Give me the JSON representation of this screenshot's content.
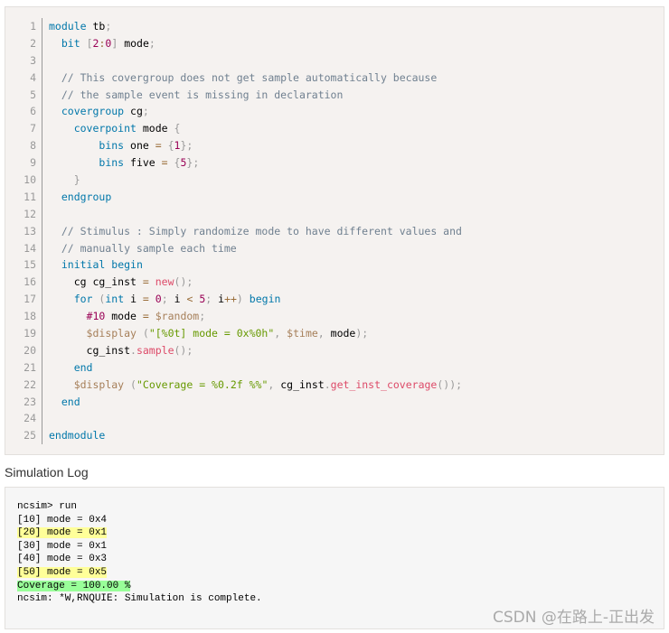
{
  "code": {
    "line_numbers": [
      "1",
      "2",
      "3",
      "4",
      "5",
      "6",
      "7",
      "8",
      "9",
      "10",
      "11",
      "12",
      "13",
      "14",
      "15",
      "16",
      "17",
      "18",
      "19",
      "20",
      "21",
      "22",
      "23",
      "24",
      "25"
    ],
    "lines": [
      [
        {
          "t": "module",
          "c": "kw"
        },
        {
          "t": " tb",
          "c": ""
        },
        {
          "t": ";",
          "c": "pun"
        }
      ],
      [
        {
          "t": "  ",
          "c": ""
        },
        {
          "t": "bit",
          "c": "kw"
        },
        {
          "t": " ",
          "c": ""
        },
        {
          "t": "[",
          "c": "pun"
        },
        {
          "t": "2",
          "c": "num"
        },
        {
          "t": ":",
          "c": "op"
        },
        {
          "t": "0",
          "c": "num"
        },
        {
          "t": "]",
          "c": "pun"
        },
        {
          "t": " mode",
          "c": ""
        },
        {
          "t": ";",
          "c": "pun"
        }
      ],
      [],
      [
        {
          "t": "  // This covergroup does not get sample automatically because",
          "c": "com"
        }
      ],
      [
        {
          "t": "  // the sample event is missing in declaration",
          "c": "com"
        }
      ],
      [
        {
          "t": "  ",
          "c": ""
        },
        {
          "t": "covergroup",
          "c": "kw"
        },
        {
          "t": " cg",
          "c": ""
        },
        {
          "t": ";",
          "c": "pun"
        }
      ],
      [
        {
          "t": "    ",
          "c": ""
        },
        {
          "t": "coverpoint",
          "c": "kw"
        },
        {
          "t": " mode ",
          "c": ""
        },
        {
          "t": "{",
          "c": "pun"
        }
      ],
      [
        {
          "t": "        ",
          "c": ""
        },
        {
          "t": "bins",
          "c": "kw"
        },
        {
          "t": " one ",
          "c": ""
        },
        {
          "t": "=",
          "c": "op"
        },
        {
          "t": " ",
          "c": ""
        },
        {
          "t": "{",
          "c": "pun"
        },
        {
          "t": "1",
          "c": "num"
        },
        {
          "t": "}",
          "c": "pun"
        },
        {
          "t": ";",
          "c": "pun"
        }
      ],
      [
        {
          "t": "        ",
          "c": ""
        },
        {
          "t": "bins",
          "c": "kw"
        },
        {
          "t": " five ",
          "c": ""
        },
        {
          "t": "=",
          "c": "op"
        },
        {
          "t": " ",
          "c": ""
        },
        {
          "t": "{",
          "c": "pun"
        },
        {
          "t": "5",
          "c": "num"
        },
        {
          "t": "}",
          "c": "pun"
        },
        {
          "t": ";",
          "c": "pun"
        }
      ],
      [
        {
          "t": "    ",
          "c": ""
        },
        {
          "t": "}",
          "c": "pun"
        }
      ],
      [
        {
          "t": "  ",
          "c": ""
        },
        {
          "t": "endgroup",
          "c": "kw"
        }
      ],
      [],
      [
        {
          "t": "  // Stimulus : Simply randomize mode to have different values and",
          "c": "com"
        }
      ],
      [
        {
          "t": "  // manually sample each time",
          "c": "com"
        }
      ],
      [
        {
          "t": "  ",
          "c": ""
        },
        {
          "t": "initial",
          "c": "kw"
        },
        {
          "t": " ",
          "c": ""
        },
        {
          "t": "begin",
          "c": "kw"
        }
      ],
      [
        {
          "t": "    cg cg_inst ",
          "c": ""
        },
        {
          "t": "=",
          "c": "op"
        },
        {
          "t": " ",
          "c": ""
        },
        {
          "t": "new",
          "c": "fn"
        },
        {
          "t": "();",
          "c": "pun"
        }
      ],
      [
        {
          "t": "    ",
          "c": ""
        },
        {
          "t": "for",
          "c": "kw"
        },
        {
          "t": " ",
          "c": ""
        },
        {
          "t": "(",
          "c": "pun"
        },
        {
          "t": "int",
          "c": "kw"
        },
        {
          "t": " i ",
          "c": ""
        },
        {
          "t": "=",
          "c": "op"
        },
        {
          "t": " ",
          "c": ""
        },
        {
          "t": "0",
          "c": "num"
        },
        {
          "t": ";",
          "c": "pun"
        },
        {
          "t": " i ",
          "c": ""
        },
        {
          "t": "<",
          "c": "op"
        },
        {
          "t": " ",
          "c": ""
        },
        {
          "t": "5",
          "c": "num"
        },
        {
          "t": ";",
          "c": "pun"
        },
        {
          "t": " i",
          "c": ""
        },
        {
          "t": "++",
          "c": "op"
        },
        {
          "t": ")",
          "c": "pun"
        },
        {
          "t": " ",
          "c": ""
        },
        {
          "t": "begin",
          "c": "kw"
        }
      ],
      [
        {
          "t": "      ",
          "c": ""
        },
        {
          "t": "#10",
          "c": "num"
        },
        {
          "t": " mode ",
          "c": ""
        },
        {
          "t": "=",
          "c": "op"
        },
        {
          "t": " ",
          "c": ""
        },
        {
          "t": "$random",
          "c": "var"
        },
        {
          "t": ";",
          "c": "pun"
        }
      ],
      [
        {
          "t": "      ",
          "c": ""
        },
        {
          "t": "$display",
          "c": "var"
        },
        {
          "t": " ",
          "c": ""
        },
        {
          "t": "(",
          "c": "pun"
        },
        {
          "t": "\"[%0t] mode = 0x%0h\"",
          "c": "str"
        },
        {
          "t": ",",
          "c": "pun"
        },
        {
          "t": " ",
          "c": ""
        },
        {
          "t": "$time",
          "c": "var"
        },
        {
          "t": ",",
          "c": "pun"
        },
        {
          "t": " mode",
          "c": ""
        },
        {
          "t": ");",
          "c": "pun"
        }
      ],
      [
        {
          "t": "      cg_inst",
          "c": ""
        },
        {
          "t": ".",
          "c": "pun"
        },
        {
          "t": "sample",
          "c": "fn"
        },
        {
          "t": "();",
          "c": "pun"
        }
      ],
      [
        {
          "t": "    ",
          "c": ""
        },
        {
          "t": "end",
          "c": "kw"
        }
      ],
      [
        {
          "t": "    ",
          "c": ""
        },
        {
          "t": "$display",
          "c": "var"
        },
        {
          "t": " ",
          "c": ""
        },
        {
          "t": "(",
          "c": "pun"
        },
        {
          "t": "\"Coverage = %0.2f %%\"",
          "c": "str"
        },
        {
          "t": ",",
          "c": "pun"
        },
        {
          "t": " cg_inst",
          "c": ""
        },
        {
          "t": ".",
          "c": "pun"
        },
        {
          "t": "get_inst_coverage",
          "c": "fn"
        },
        {
          "t": "());",
          "c": "pun"
        }
      ],
      [
        {
          "t": "  ",
          "c": ""
        },
        {
          "t": "end",
          "c": "kw"
        }
      ],
      [],
      [
        {
          "t": "endmodule",
          "c": "kw"
        }
      ]
    ]
  },
  "section_title": "Simulation Log",
  "log": [
    {
      "text": "ncsim> run",
      "hl": ""
    },
    {
      "text": "[10] mode = 0x4",
      "hl": ""
    },
    {
      "text": "[20] mode = 0x1",
      "hl": "yellow"
    },
    {
      "text": "[30] mode = 0x1",
      "hl": ""
    },
    {
      "text": "[40] mode = 0x3",
      "hl": ""
    },
    {
      "text": "[50] mode = 0x5",
      "hl": "yellow"
    },
    {
      "text": "Coverage = 100.00 %",
      "hl": "green"
    },
    {
      "text": "ncsim: *W,RNQUIE: Simulation is complete.",
      "hl": ""
    }
  ],
  "watermark": "CSDN @在路上-正出发"
}
